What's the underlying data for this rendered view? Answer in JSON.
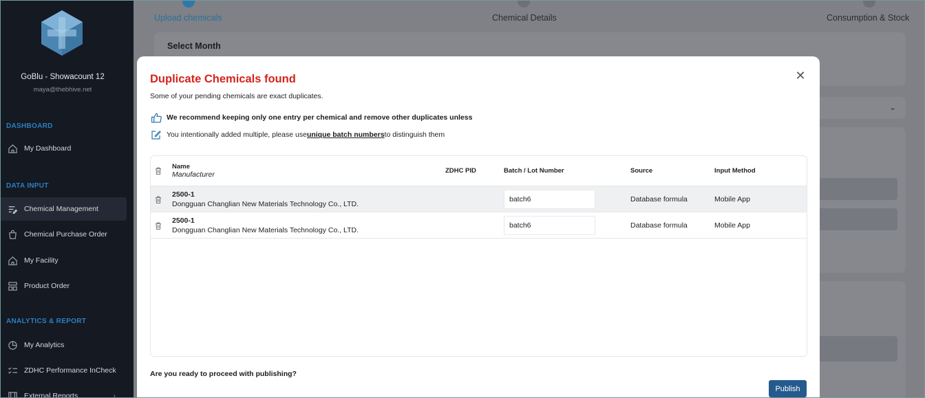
{
  "app": {
    "brand_colors": {
      "accent": "#2f78ab",
      "danger": "#d5231d",
      "sidebar_bg": "#141922",
      "primary_button": "#245a8d"
    }
  },
  "sidebar": {
    "user_name": "GoBlu - Showacount 12",
    "user_email": "maya@thebhive.net",
    "sections": [
      {
        "title": "DASHBOARD",
        "items": [
          {
            "label": "My Dashboard",
            "icon": "home-icon"
          }
        ]
      },
      {
        "title": "DATA INPUT",
        "items": [
          {
            "label": "Chemical Management",
            "icon": "list-edit-icon",
            "active": true
          },
          {
            "label": "Chemical Purchase Order",
            "icon": "shopping-bag-icon"
          },
          {
            "label": "My Facility",
            "icon": "home-icon"
          },
          {
            "label": "Product Order",
            "icon": "product-order-icon"
          }
        ]
      },
      {
        "title": "ANALYTICS & REPORT",
        "items": [
          {
            "label": "My Analytics",
            "icon": "pie-chart-icon"
          },
          {
            "label": "ZDHC Performance InCheck",
            "icon": "checklist-icon"
          },
          {
            "label": "External Reports",
            "icon": "report-icon"
          }
        ]
      }
    ]
  },
  "steps": [
    {
      "label": "Upload chemicals",
      "active": true
    },
    {
      "label": "Chemical Details",
      "active": false
    },
    {
      "label": "Consumption & Stock",
      "active": false
    }
  ],
  "background": {
    "select_month_label": "Select Month"
  },
  "modal": {
    "title": "Duplicate Chemicals found",
    "subtitle": "Some of your pending chemicals are exact duplicates.",
    "recommendation": "We recommend keeping only one entry per chemical and remove other duplicates unless",
    "note_prefix": "You intentionally added multiple, please use ",
    "note_link": "unique batch numbers ",
    "note_suffix": "to distinguish them",
    "table": {
      "columns": {
        "name": "Name",
        "manufacturer": "Manufacturer",
        "zdhc_pid": "ZDHC PID",
        "batch": "Batch / Lot Number",
        "source": "Source",
        "input_method": "Input Method"
      },
      "rows": [
        {
          "name": "2500-1",
          "manufacturer": "Dongguan Changlian New Materials Technology Co., LTD.",
          "zdhc_pid": "",
          "batch": "batch6",
          "source": "Database formula",
          "input_method": "Mobile App"
        },
        {
          "name": "2500-1",
          "manufacturer": "Dongguan Changlian New Materials Technology Co., LTD.",
          "zdhc_pid": "",
          "batch": "batch6",
          "source": "Database formula",
          "input_method": "Mobile App"
        }
      ]
    },
    "proceed_question": "Are you ready to proceed with publishing?",
    "publish_label": "Publish"
  }
}
